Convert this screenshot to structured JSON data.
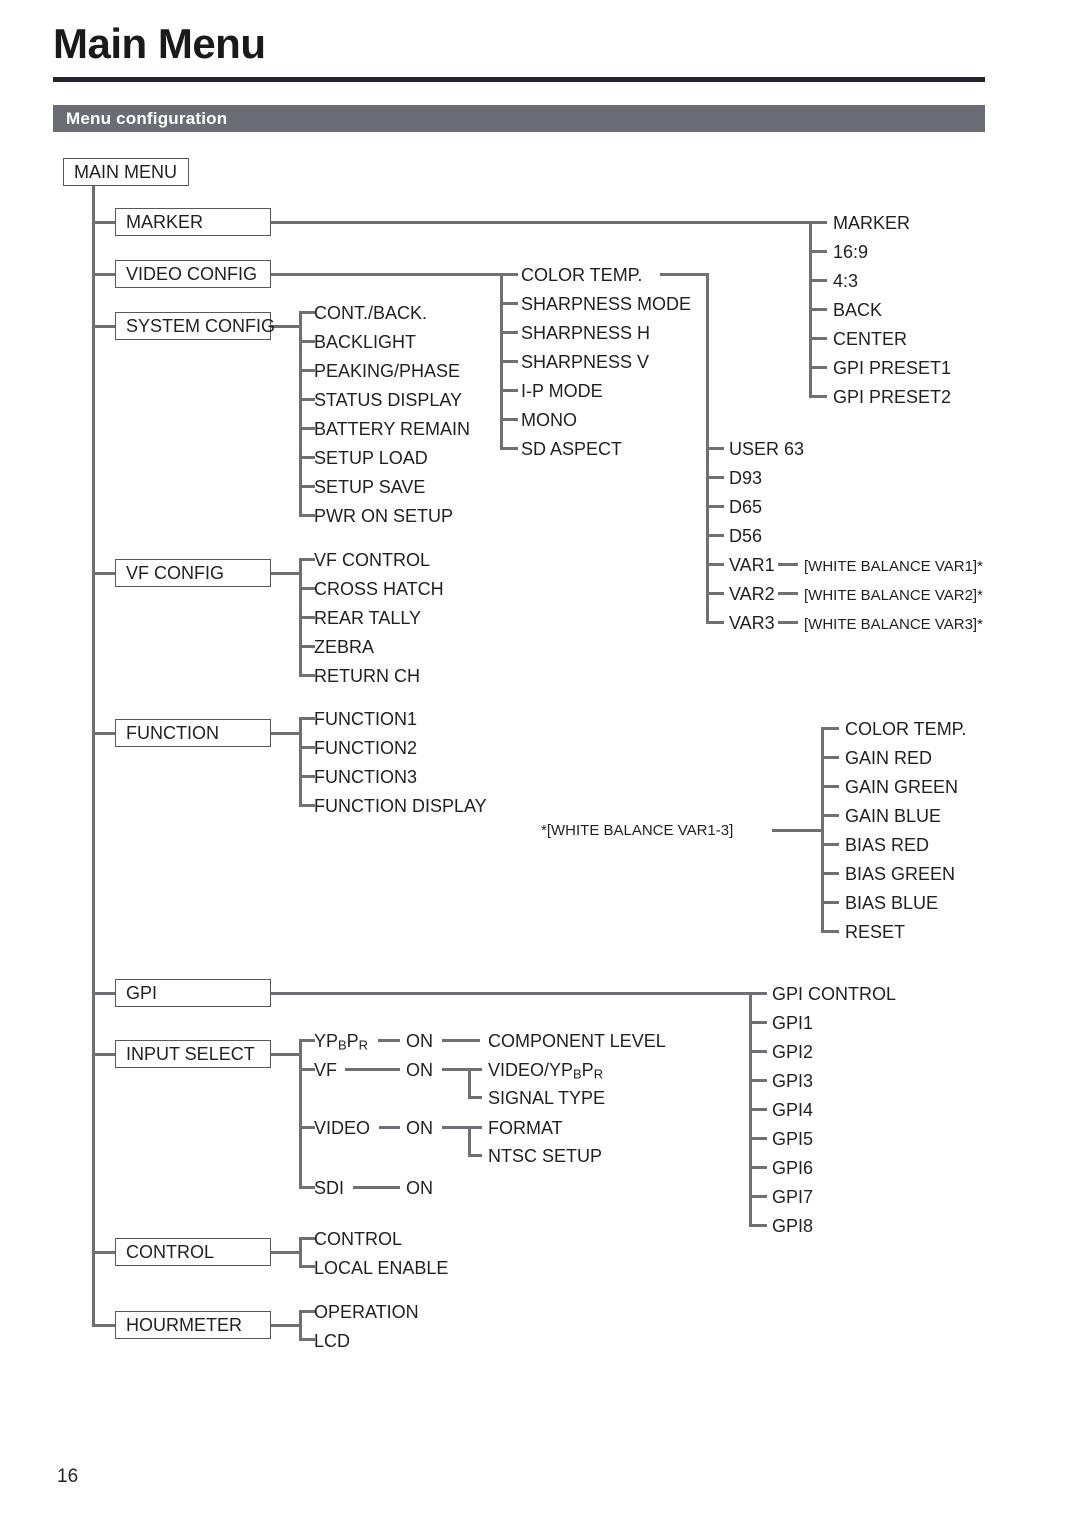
{
  "page": {
    "title": "Main Menu",
    "section_heading": "Menu configuration",
    "page_number": "16"
  },
  "diagram": {
    "root": "MAIN MENU",
    "branches": [
      {
        "label": "MARKER",
        "children": []
      },
      {
        "label": "VIDEO CONFIG",
        "children": []
      },
      {
        "label": "SYSTEM CONFIG",
        "children": [
          "CONT./BACK.",
          "BACKLIGHT",
          "PEAKING/PHASE",
          "STATUS DISPLAY",
          "BATTERY REMAIN",
          "SETUP LOAD",
          "SETUP SAVE",
          "PWR ON SETUP"
        ]
      },
      {
        "label": "VF CONFIG",
        "children": [
          "VF CONTROL",
          "CROSS HATCH",
          "REAR TALLY",
          "ZEBRA",
          "RETURN CH"
        ]
      },
      {
        "label": "FUNCTION",
        "children": [
          "FUNCTION1",
          "FUNCTION2",
          "FUNCTION3",
          "FUNCTION DISPLAY"
        ]
      },
      {
        "label": "GPI",
        "children": []
      },
      {
        "label": "INPUT SELECT",
        "children": []
      },
      {
        "label": "CONTROL",
        "children": [
          "CONTROL",
          "LOCAL ENABLE"
        ]
      },
      {
        "label": "HOURMETER",
        "children": [
          "OPERATION",
          "LCD"
        ]
      }
    ],
    "marker_items": [
      "MARKER",
      "16:9",
      "4:3",
      "BACK",
      "CENTER",
      "GPI PRESET1",
      "GPI PRESET2"
    ],
    "video_config_items": [
      "COLOR TEMP.",
      "SHARPNESS MODE",
      "SHARPNESS H",
      "SHARPNESS V",
      "I-P MODE",
      "MONO",
      "SD ASPECT"
    ],
    "color_temp_items": [
      {
        "label": "USER  63",
        "link": ""
      },
      {
        "label": "D93",
        "link": ""
      },
      {
        "label": "D65",
        "link": ""
      },
      {
        "label": "D56",
        "link": ""
      },
      {
        "label": "VAR1",
        "link": "[WHITE BALANCE VAR1]*"
      },
      {
        "label": "VAR2",
        "link": "[WHITE BALANCE VAR2]*"
      },
      {
        "label": "VAR3",
        "link": "[WHITE BALANCE VAR3]*"
      }
    ],
    "white_balance_note": "*[WHITE BALANCE VAR1-3]",
    "white_balance_items": [
      "COLOR TEMP.",
      "GAIN RED",
      "GAIN GREEN",
      "GAIN BLUE",
      "BIAS RED",
      "BIAS GREEN",
      "BIAS BLUE",
      "RESET"
    ],
    "gpi_items": [
      "GPI CONTROL",
      "GPI1",
      "GPI2",
      "GPI3",
      "GPI4",
      "GPI5",
      "GPI6",
      "GPI7",
      "GPI8"
    ],
    "input_select": {
      "ypbpr_label_pre": "YP",
      "ypbpr_sub_b": "B",
      "ypbpr_mid": "P",
      "ypbpr_sub_r": "R",
      "vf_label": "VF",
      "video_label": "VIDEO",
      "sdi_label": "SDI",
      "on_label": "ON",
      "component_level": "COMPONENT LEVEL",
      "video_ypbpr_pre": "VIDEO/YP",
      "video_ypbpr_mid": "P",
      "signal_type": "SIGNAL TYPE",
      "format": "FORMAT",
      "ntsc_setup": "NTSC SETUP"
    }
  },
  "colors": {
    "rule": "#2b2230",
    "section_bar": "#6c6d74",
    "connector": "#6e7076",
    "box_border": "#57585c",
    "text": "#231f20"
  }
}
